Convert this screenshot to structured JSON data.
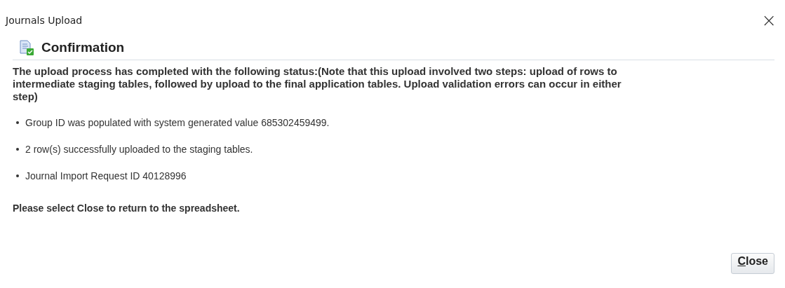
{
  "window": {
    "title": "Journals Upload",
    "close": "×"
  },
  "header": {
    "title": "Confirmation"
  },
  "message": "The upload process has completed with the following status:(Note that this upload involved two steps: upload of rows to intermediate staging tables, followed by upload to the final application tables. Upload validation errors can occur in either step)",
  "items": [
    "Group ID was populated with system generated value 685302459499.",
    "2 row(s) successfully uploaded to the staging tables.",
    "Journal Import Request ID 40128996"
  ],
  "instruction": "Please select Close to return to the spreadsheet.",
  "buttons": [
    "Close"
  ]
}
